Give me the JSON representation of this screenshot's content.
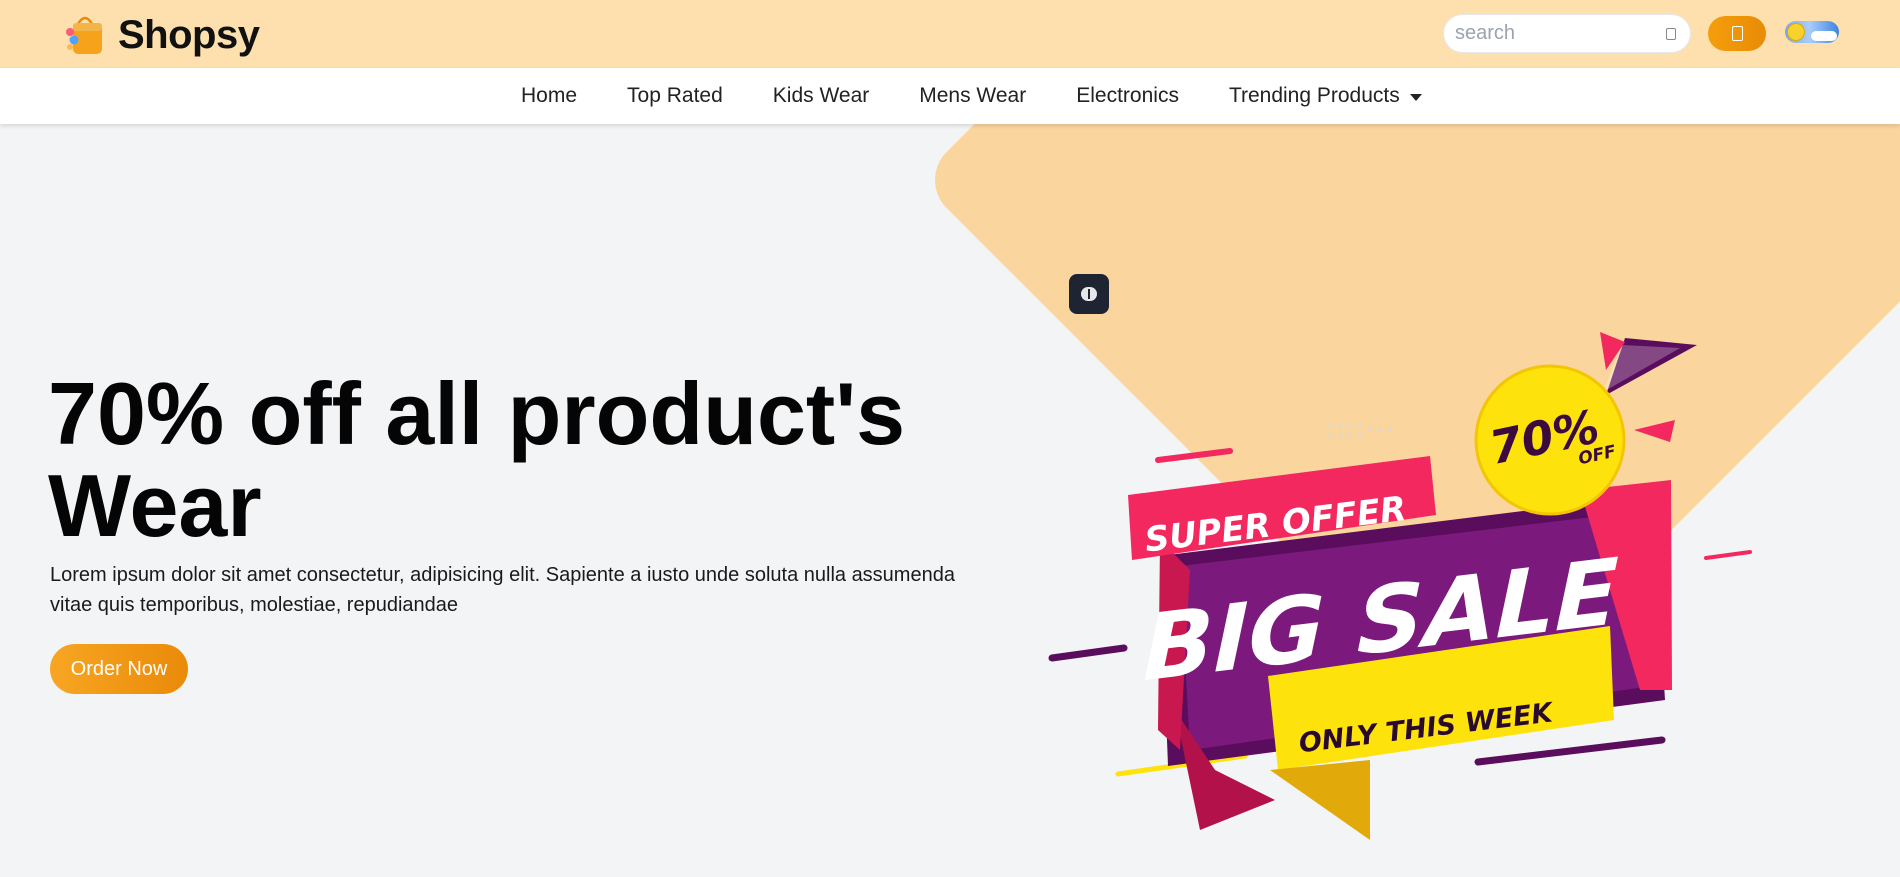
{
  "brand": {
    "name": "Shopsy",
    "logo_icon": "shopping-bag-icon"
  },
  "search": {
    "placeholder": "search",
    "value": "",
    "icon": "search-icon"
  },
  "header_actions": {
    "cart_icon": "cart-icon",
    "theme_toggle_icon": "sun-cloud-toggle-icon"
  },
  "nav": {
    "items": [
      {
        "label": "Home"
      },
      {
        "label": "Top Rated"
      },
      {
        "label": "Kids Wear"
      },
      {
        "label": "Mens Wear"
      },
      {
        "label": "Electronics"
      },
      {
        "label": "Trending Products",
        "has_dropdown": true
      }
    ]
  },
  "hero": {
    "headline": "70% off all product's Wear",
    "description": "Lorem ipsum dolor sit amet consectetur, adipisicing elit. Sapiente a iusto unde soluta nulla assumenda vitae quis temporibus, molestiae, repudiandae",
    "cta_label": "Order Now",
    "floating_icon": "brain-icon",
    "banner": {
      "super_offer": "SUPER OFFER",
      "big_sale": "BIG SALE",
      "only_week": "ONLY THIS WEEK",
      "badge_percent": "70%",
      "badge_off": "OFF"
    }
  },
  "colors": {
    "topbar_bg": "#fde0ad",
    "accent": "#f59e0b",
    "hero_bg": "#f3f4f6",
    "hero_shape": "#fad69e",
    "banner_pink": "#f2285e",
    "banner_purple": "#5b0d5d",
    "banner_yellow": "#fde30b"
  }
}
